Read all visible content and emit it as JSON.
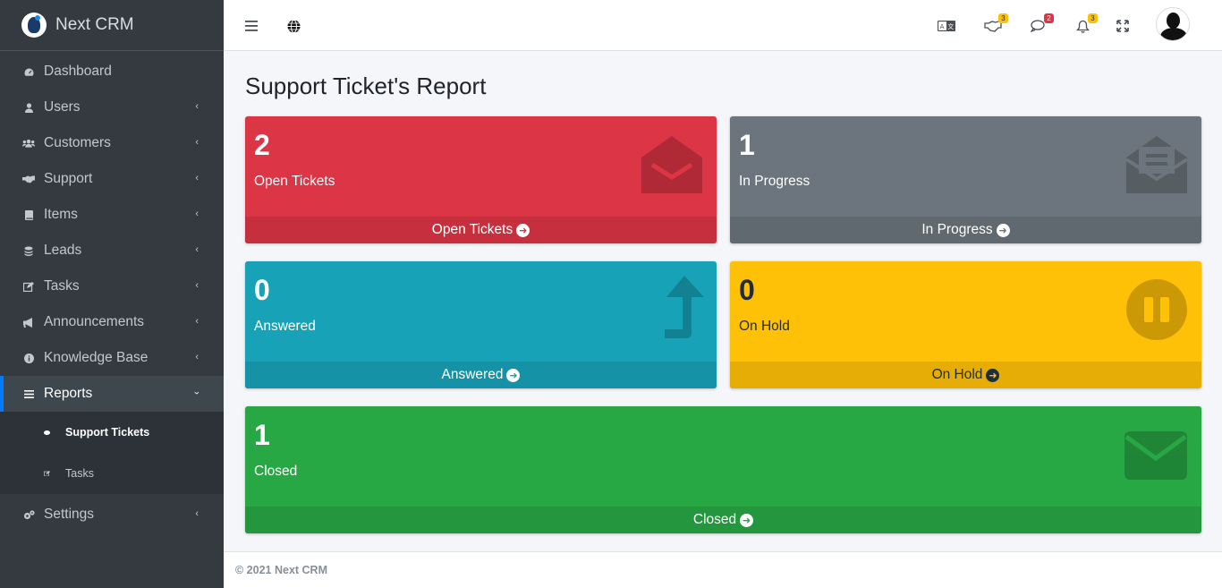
{
  "brand": {
    "name": "Next CRM"
  },
  "sidebar": {
    "items": [
      {
        "label": "Dashboard",
        "icon": "tachometer-icon"
      },
      {
        "label": "Users",
        "icon": "user-icon"
      },
      {
        "label": "Customers",
        "icon": "users-icon"
      },
      {
        "label": "Support",
        "icon": "handshake-icon"
      },
      {
        "label": "Items",
        "icon": "book-icon"
      },
      {
        "label": "Leads",
        "icon": "layers-icon"
      },
      {
        "label": "Tasks",
        "icon": "edit-icon"
      },
      {
        "label": "Announcements",
        "icon": "bullhorn-icon"
      },
      {
        "label": "Knowledge Base",
        "icon": "info-circle-icon"
      },
      {
        "label": "Reports",
        "icon": "list-icon"
      }
    ],
    "reports_submenu": [
      {
        "label": "Support Tickets",
        "icon": "circle-icon",
        "active": true
      },
      {
        "label": "Tasks",
        "icon": "edit-icon",
        "active": false
      }
    ],
    "settings": {
      "label": "Settings",
      "icon": "cogs-icon"
    }
  },
  "topbar": {
    "handshake_badge": "3",
    "messages_badge": "2",
    "notifications_badge": "3"
  },
  "page": {
    "title": "Support Ticket's Report"
  },
  "boxes": {
    "open": {
      "count": "2",
      "label": "Open Tickets",
      "footer": "Open Tickets"
    },
    "progress": {
      "count": "1",
      "label": "In Progress",
      "footer": "In Progress"
    },
    "answered": {
      "count": "0",
      "label": "Answered",
      "footer": "Answered"
    },
    "hold": {
      "count": "0",
      "label": "On Hold",
      "footer": "On Hold"
    },
    "closed": {
      "count": "1",
      "label": "Closed",
      "footer": "Closed"
    }
  },
  "colors": {
    "open": "#dc3545",
    "progress": "#6c757d",
    "answered": "#17a2b8",
    "hold": "#ffc107",
    "closed": "#28a745",
    "sidebar": "#343a40",
    "active_accent": "#007bff"
  },
  "footer": {
    "text": "© 2021 Next CRM"
  }
}
